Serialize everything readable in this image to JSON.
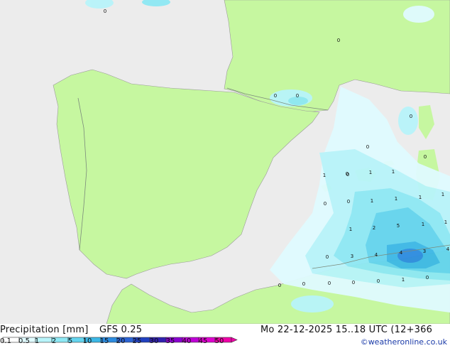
{
  "map": {
    "colors": {
      "sea": "#ececec",
      "land": "#c6f7a0",
      "border": "#7b8a7b",
      "coast": "#9a9a9a"
    },
    "labels": [
      {
        "id": "l1",
        "text": "0"
      },
      {
        "id": "l2",
        "text": "0"
      },
      {
        "id": "l3",
        "text": "0"
      },
      {
        "id": "l4",
        "text": "0"
      },
      {
        "id": "l5",
        "text": "0"
      },
      {
        "id": "l6",
        "text": "0"
      },
      {
        "id": "l7",
        "text": "0"
      },
      {
        "id": "l8",
        "text": "1"
      },
      {
        "id": "l9",
        "text": "0"
      },
      {
        "id": "l10",
        "text": "1"
      },
      {
        "id": "l11",
        "text": "1"
      },
      {
        "id": "l12",
        "text": "1"
      },
      {
        "id": "l13",
        "text": "0"
      },
      {
        "id": "l14",
        "text": "0"
      },
      {
        "id": "l15",
        "text": "1"
      },
      {
        "id": "l16",
        "text": "1"
      },
      {
        "id": "l17",
        "text": "1"
      },
      {
        "id": "l18",
        "text": "1"
      },
      {
        "id": "l19",
        "text": "1"
      },
      {
        "id": "l20",
        "text": "2"
      },
      {
        "id": "l21",
        "text": "5"
      },
      {
        "id": "l22",
        "text": "1"
      },
      {
        "id": "l23",
        "text": "0"
      },
      {
        "id": "l24",
        "text": "0"
      },
      {
        "id": "l25",
        "text": "3"
      },
      {
        "id": "l26",
        "text": "4"
      },
      {
        "id": "l27",
        "text": "4"
      },
      {
        "id": "l28",
        "text": "3"
      },
      {
        "id": "l29",
        "text": "4"
      },
      {
        "id": "l30",
        "text": "0"
      },
      {
        "id": "l31",
        "text": "0"
      },
      {
        "id": "l32",
        "text": "0"
      },
      {
        "id": "l33",
        "text": "0"
      },
      {
        "id": "l34",
        "text": "0"
      },
      {
        "id": "l35",
        "text": "1"
      },
      {
        "id": "l36",
        "text": "0"
      }
    ]
  },
  "footer": {
    "title_left": "Precipitation [mm]",
    "model": "GFS 0.25",
    "title_right": "Mo 22-12-2025 15..18 UTC (12+366",
    "credit": "©weatheronline.co.uk",
    "scale_ticks": [
      "0.1",
      "0.5",
      "1",
      "2",
      "5",
      "10",
      "15",
      "20",
      "25",
      "30",
      "35",
      "40",
      "45",
      "50"
    ],
    "scale_colors": [
      "#ffffff",
      "#e0fbff",
      "#b8f4fa",
      "#8ee8f4",
      "#64d4ee",
      "#3cb8e6",
      "#2c8ce0",
      "#2c64d4",
      "#2040c0",
      "#3020b0",
      "#8a00d0",
      "#c000d8",
      "#e000d0",
      "#f000a8"
    ]
  }
}
